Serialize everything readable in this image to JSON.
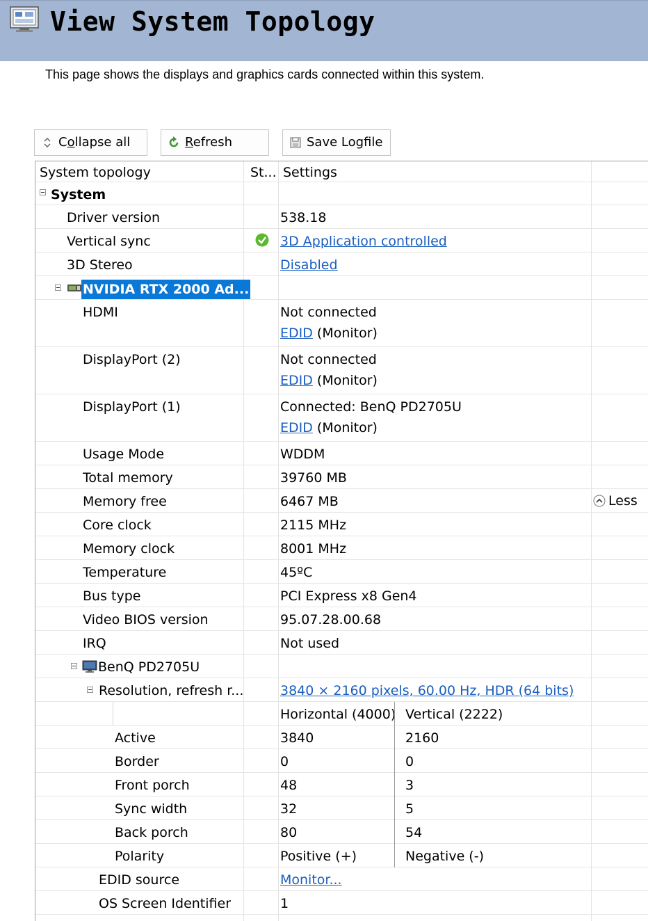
{
  "header": {
    "title": "View System Topology",
    "description": "This page shows the displays and graphics cards connected within this system."
  },
  "toolbar": {
    "collapse_pre": "C",
    "collapse_u": "o",
    "collapse_post": "llapse all",
    "refresh_u": "R",
    "refresh_post": "efresh",
    "save_label": "Save Logfile"
  },
  "columns": {
    "topology": "System topology",
    "status": "St...",
    "settings": "Settings"
  },
  "tree": {
    "system": "System",
    "driver_label": "Driver version",
    "driver_value": "538.18",
    "vsync_label": "Vertical sync",
    "vsync_value": "3D Application controlled",
    "stereo_label": "3D Stereo",
    "stereo_value": "Disabled",
    "gpu_name": "NVIDIA RTX 2000 Ad...",
    "edid_link": "EDID",
    "monitor_suffix": "(Monitor)",
    "hdmi_label": "HDMI",
    "hdmi_status": "Not connected",
    "dp2_label": "DisplayPort (2)",
    "dp2_status": "Not connected",
    "dp1_label": "DisplayPort (1)",
    "dp1_status": "Connected: BenQ PD2705U",
    "usage_label": "Usage Mode",
    "usage_value": "WDDM",
    "total_mem_label": "Total memory",
    "total_mem_value": "39760 MB",
    "mem_free_label": "Memory free",
    "mem_free_value": "6467 MB",
    "less_label": "Less",
    "core_clock_label": "Core clock",
    "core_clock_value": "2115 MHz",
    "mem_clock_label": "Memory clock",
    "mem_clock_value": "8001 MHz",
    "temp_label": "Temperature",
    "temp_value": "45ºC",
    "bus_label": "Bus type",
    "bus_value": "PCI Express x8 Gen4",
    "vbios_label": "Video BIOS version",
    "vbios_value": "95.07.28.00.68",
    "irq_label": "IRQ",
    "irq_value": "Not used",
    "monitor_name": "BenQ PD2705U",
    "resolution_label": "Resolution, refresh r...",
    "resolution_value": "3840 × 2160 pixels, 60.00 Hz, HDR (64 bits)",
    "timing_h_header": "Horizontal (4000)",
    "timing_v_header": "Vertical (2222)",
    "edid_source_label": "EDID source",
    "edid_source_value": "Monitor...",
    "os_id_label": "OS Screen Identifier",
    "os_id_value": "1"
  },
  "timings": [
    {
      "label": "Active",
      "h": "3840",
      "v": "2160"
    },
    {
      "label": "Border",
      "h": "0",
      "v": "0"
    },
    {
      "label": "Front porch",
      "h": "48",
      "v": "3"
    },
    {
      "label": "Sync width",
      "h": "32",
      "v": "5"
    },
    {
      "label": "Back porch",
      "h": "80",
      "v": "54"
    },
    {
      "label": "Polarity",
      "h": "Positive (+)",
      "v": "Negative (-)"
    }
  ]
}
